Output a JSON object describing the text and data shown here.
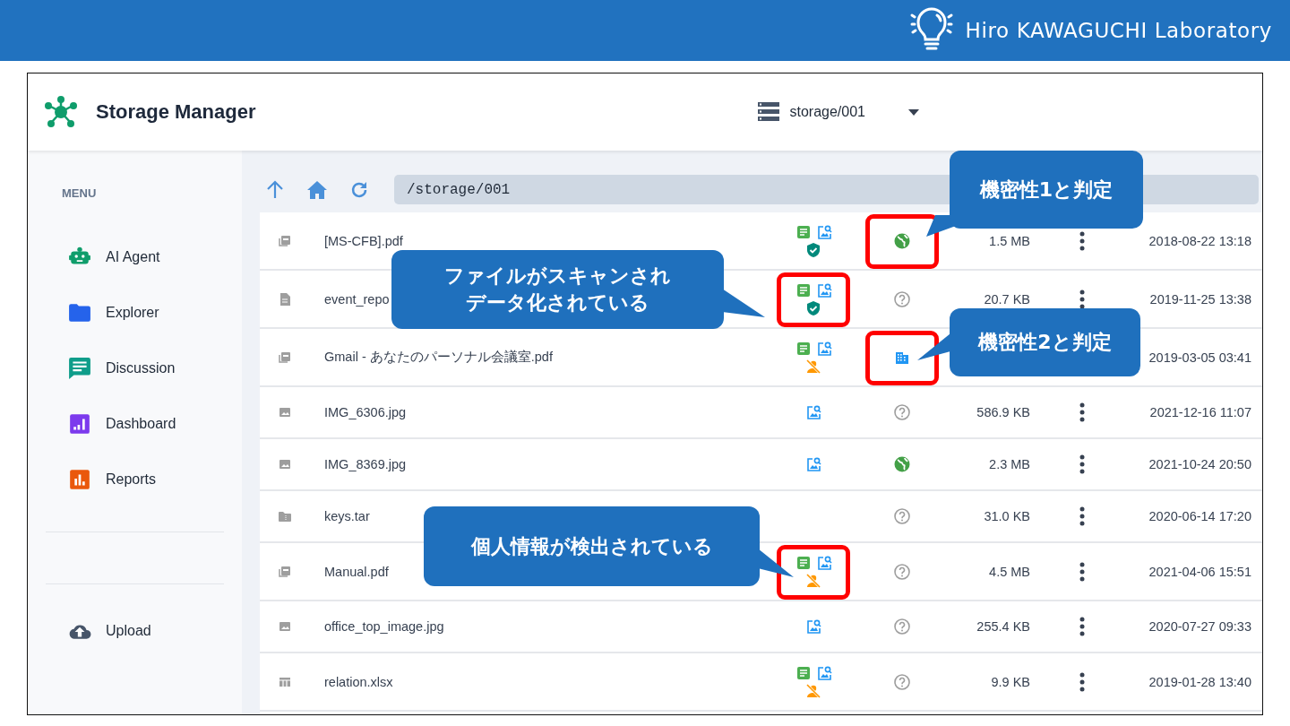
{
  "banner": {
    "title": "Hiro KAWAGUCHI Laboratory"
  },
  "app": {
    "title": "Storage Manager",
    "storage": "storage/001"
  },
  "sidebar": {
    "heading": "MENU",
    "items": [
      {
        "label": "AI Agent"
      },
      {
        "label": "Explorer"
      },
      {
        "label": "Discussion"
      },
      {
        "label": "Dashboard"
      },
      {
        "label": "Reports"
      }
    ],
    "footer": [
      {
        "label": "Upload"
      }
    ]
  },
  "toolbar": {
    "path": "/storage/001"
  },
  "files": [
    {
      "kind": "pdf",
      "name": "[MS-CFB].pdf",
      "badges": [
        {
          "kind": "text"
        },
        {
          "kind": "image"
        },
        {
          "kind": "safe"
        }
      ],
      "sensitivity": {
        "kind": "public"
      },
      "size": "1.5 MB",
      "date": "2018-08-22 13:18",
      "menu": true,
      "mark_badges": false,
      "mark_sensitivity": true
    },
    {
      "kind": "doc",
      "name": "event_repo",
      "badges": [
        {
          "kind": "text"
        },
        {
          "kind": "image"
        },
        {
          "kind": "safe"
        }
      ],
      "sensitivity": {
        "kind": "unknown"
      },
      "size": "20.7 KB",
      "date": "2019-11-25 13:38",
      "menu": true,
      "mark_badges": true,
      "mark_sensitivity": false
    },
    {
      "kind": "pdf",
      "name": "Gmail - あなたのパーソナル会議室.pdf",
      "badges": [
        {
          "kind": "text"
        },
        {
          "kind": "image"
        },
        {
          "kind": "pii"
        }
      ],
      "sensitivity": {
        "kind": "internal"
      },
      "date": "2019-03-05 03:41",
      "menu": false,
      "mark_badges": false,
      "mark_sensitivity": true
    },
    {
      "kind": "image",
      "name": "IMG_6306.jpg",
      "badges": [
        {
          "kind": "image"
        }
      ],
      "sensitivity": {
        "kind": "unknown"
      },
      "size": "586.9 KB",
      "date": "2021-12-16 11:07",
      "menu": true,
      "mark_badges": false,
      "mark_sensitivity": false
    },
    {
      "kind": "image",
      "name": "IMG_8369.jpg",
      "badges": [
        {
          "kind": "image"
        }
      ],
      "sensitivity": {
        "kind": "public"
      },
      "size": "2.3 MB",
      "date": "2021-10-24 20:50",
      "menu": true,
      "mark_badges": false,
      "mark_sensitivity": false
    },
    {
      "kind": "archive",
      "name": "keys.tar",
      "sensitivity": {
        "kind": "unknown"
      },
      "size": "31.0 KB",
      "date": "2020-06-14 17:20",
      "menu": true,
      "mark_badges": false,
      "mark_sensitivity": false
    },
    {
      "kind": "pdf",
      "name": "Manual.pdf",
      "badges": [
        {
          "kind": "text"
        },
        {
          "kind": "image"
        },
        {
          "kind": "pii"
        }
      ],
      "sensitivity": {
        "kind": "unknown"
      },
      "size": "4.5 MB",
      "date": "2021-04-06 15:51",
      "menu": true,
      "mark_badges": true,
      "mark_sensitivity": false
    },
    {
      "kind": "image",
      "name": "office_top_image.jpg",
      "badges": [
        {
          "kind": "image"
        }
      ],
      "sensitivity": {
        "kind": "unknown"
      },
      "size": "255.4 KB",
      "date": "2020-07-27 09:33",
      "menu": true,
      "mark_badges": false,
      "mark_sensitivity": false
    },
    {
      "kind": "sheet",
      "name": "relation.xlsx",
      "badges": [
        {
          "kind": "text"
        },
        {
          "kind": "image"
        },
        {
          "kind": "pii"
        }
      ],
      "sensitivity": {
        "kind": "unknown"
      },
      "size": "9.9 KB",
      "date": "2019-01-28 13:40",
      "menu": true,
      "mark_badges": false,
      "mark_sensitivity": false
    }
  ],
  "callouts": [
    {
      "lines": [
        "機密性1と判定"
      ]
    },
    {
      "lines": [
        "ファイルがスキャンされ",
        "データ化されている"
      ]
    },
    {
      "lines": [
        "機密性2と判定"
      ]
    },
    {
      "lines": [
        "個人情報が検出されている"
      ]
    }
  ]
}
